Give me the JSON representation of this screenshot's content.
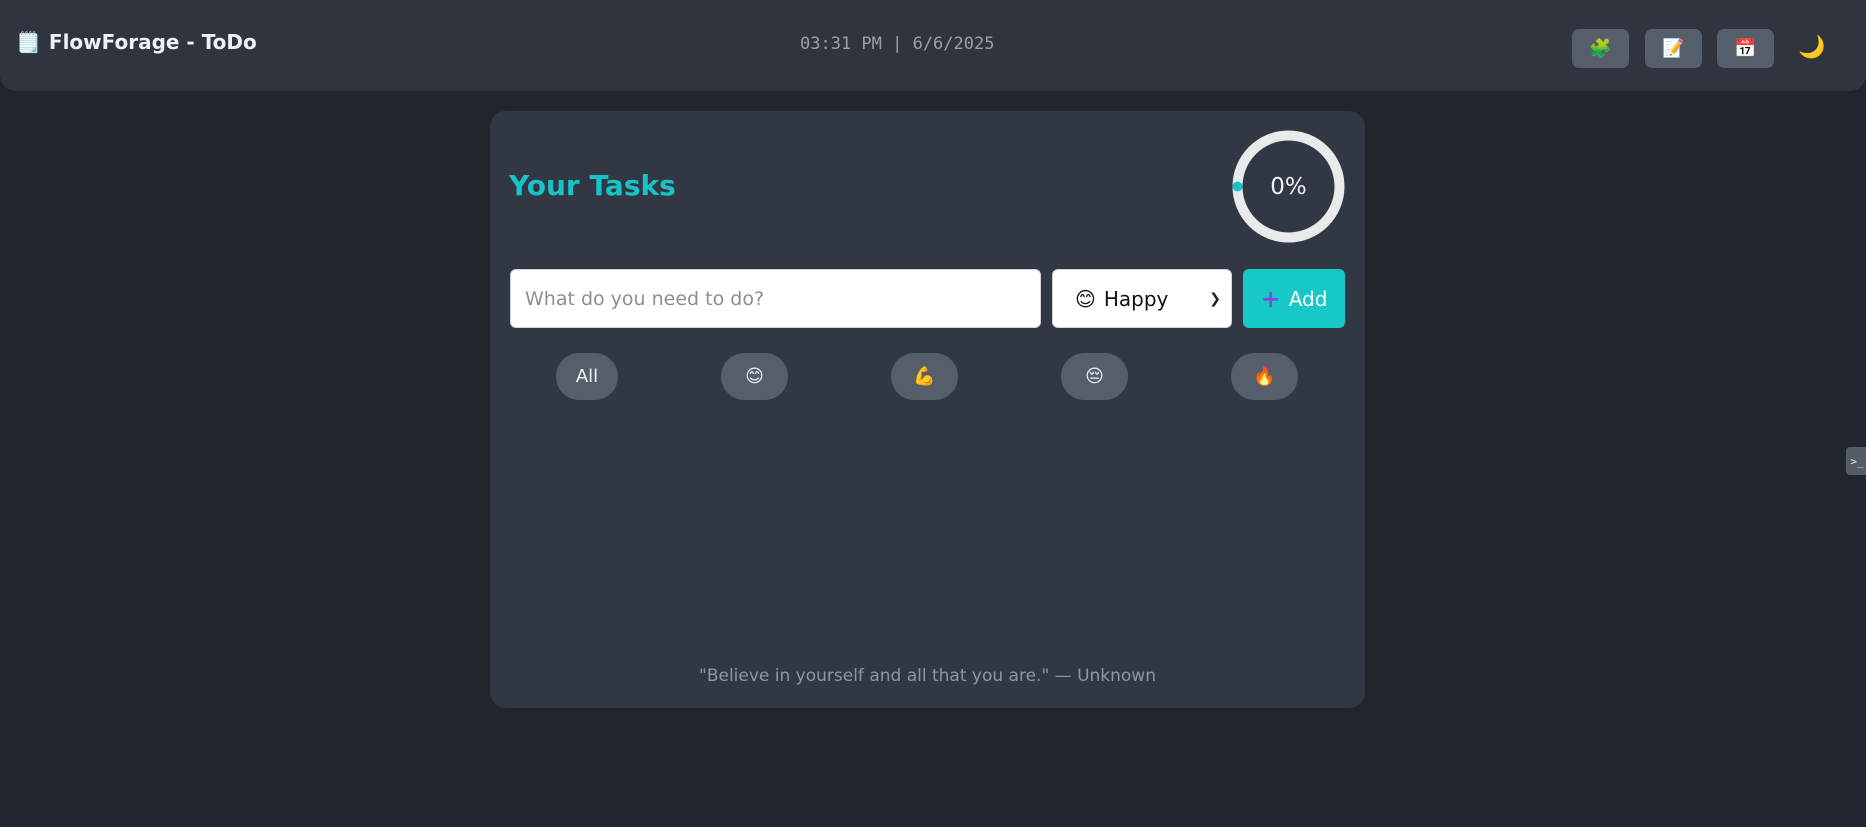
{
  "header": {
    "logo_icon": "🗒️",
    "title": "FlowForage - ToDo",
    "datetime": "03:31 PM | 6/6/2025",
    "buttons": [
      {
        "icon": "🧩",
        "icon_name": "puzzle-icon"
      },
      {
        "icon": "📝",
        "icon_name": "notes-icon"
      },
      {
        "icon": "📅",
        "icon_name": "calendar-icon"
      }
    ],
    "theme_icon": "🌙"
  },
  "card": {
    "title": "Your Tasks",
    "progress": {
      "value": 0,
      "label": "0%"
    },
    "input": {
      "placeholder": "What do you need to do?",
      "value": ""
    },
    "mood_select": {
      "icon": "😊",
      "selected": "Happy"
    },
    "add_button": {
      "icon": "➕",
      "label": "Add"
    },
    "filters": [
      {
        "label": "All"
      },
      {
        "label": "😊"
      },
      {
        "label": "💪"
      },
      {
        "label": "😔"
      },
      {
        "label": "🔥"
      }
    ],
    "quote": "\"Believe in yourself and all that you are.\" — Unknown"
  },
  "side_tab": {
    "label": ">_"
  },
  "colors": {
    "accent": "#17c3c7",
    "background": "#20252e",
    "card": "#323843",
    "button": "#575e6b"
  }
}
